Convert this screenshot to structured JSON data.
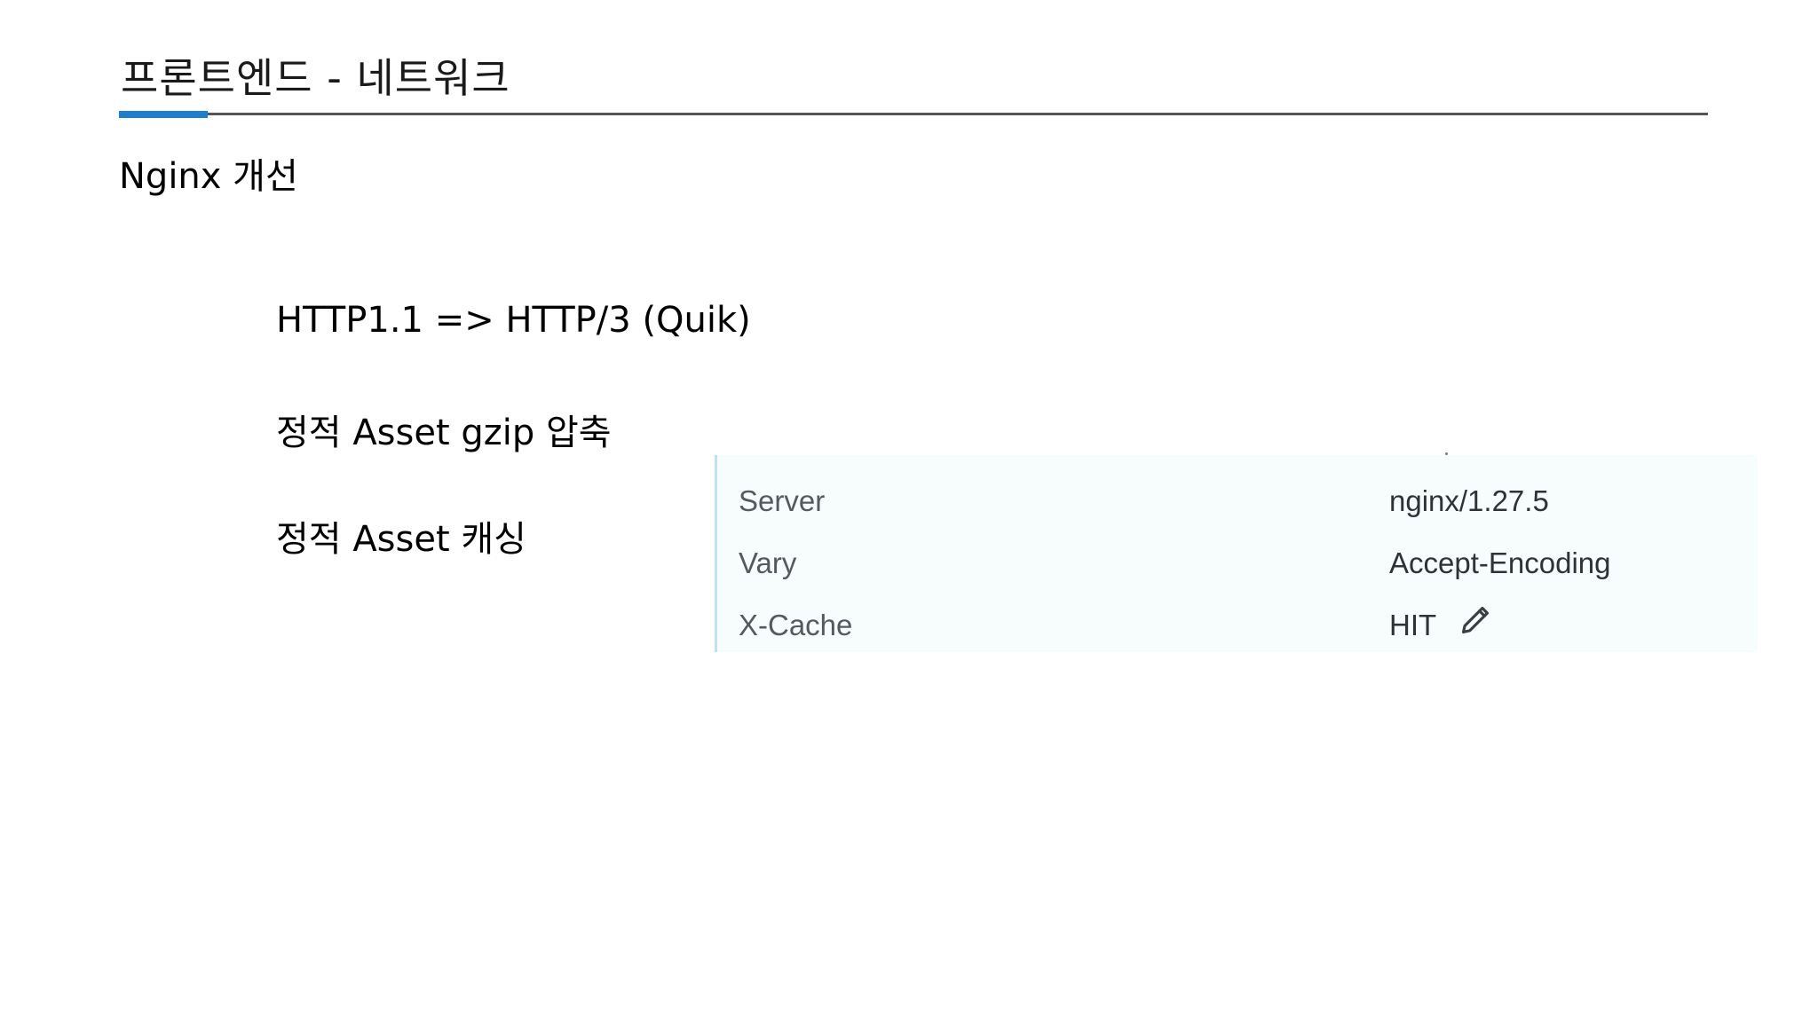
{
  "slide": {
    "title": "프론트엔드 - 네트워크",
    "heading": "Nginx 개선",
    "bullets": [
      "HTTP1.1 => HTTP/3 (Quik)",
      "정적 Asset gzip 압축",
      "정적 Asset 캐싱"
    ]
  },
  "headers_panel": {
    "rows": [
      {
        "name": "Server",
        "value": "nginx/1.27.5"
      },
      {
        "name": "Vary",
        "value": "Accept-Encoding"
      },
      {
        "name": "X-Cache",
        "value": "HIT",
        "icon": "pencil-icon"
      }
    ]
  },
  "colors": {
    "accent": "#1e7fd0",
    "rule": "#555555",
    "panel_background": "#f7fcfd",
    "panel_border": "#bfe3ef"
  }
}
